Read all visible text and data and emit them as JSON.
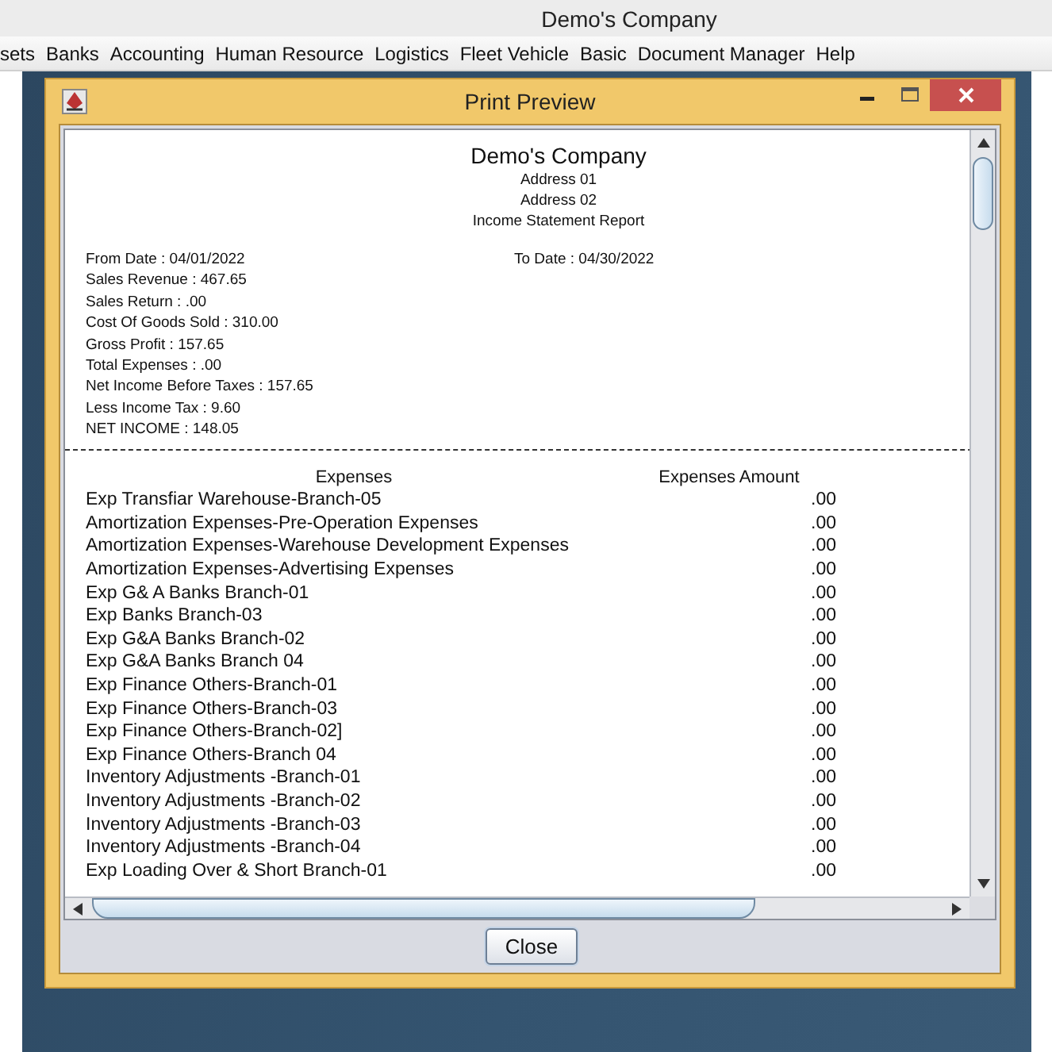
{
  "window": {
    "title": "Demo's Company"
  },
  "menu": [
    "sets",
    "Banks",
    "Accounting",
    "Human Resource",
    "Logistics",
    "Fleet Vehicle",
    "Basic",
    "Document Manager",
    "Help"
  ],
  "dialog": {
    "title": "Print Preview",
    "close_button": "Close"
  },
  "report": {
    "company": "Demo's Company",
    "address_lines": [
      "Address 01",
      "Address 02"
    ],
    "report_title": "Income Statement Report",
    "from_date": "From Date : 04/01/2022",
    "to_date": "To Date : 04/30/2022",
    "summary": [
      "Sales Revenue : 467.65",
      "Sales Return : .00",
      "Cost Of Goods Sold : 310.00",
      "Gross Profit : 157.65",
      "Total Expenses : .00",
      "Net Income Before Taxes : 157.65",
      "Less Income Tax : 9.60",
      "NET INCOME : 148.05"
    ],
    "columns": [
      "Expenses",
      "Expenses Amount"
    ],
    "rows": [
      {
        "name": "Exp Transfiar Warehouse-Branch-05",
        "amount": ".00"
      },
      {
        "name": "Amortization Expenses-Pre-Operation Expenses",
        "amount": ".00"
      },
      {
        "name": "Amortization  Expenses-Warehouse Development Expenses",
        "amount": ".00"
      },
      {
        "name": "Amortization  Expenses-Advertising Expenses",
        "amount": ".00"
      },
      {
        "name": "Exp G& A Banks Branch-01",
        "amount": ".00"
      },
      {
        "name": "Exp Banks Branch-03",
        "amount": ".00"
      },
      {
        "name": "Exp G&A Banks Branch-02",
        "amount": ".00"
      },
      {
        "name": "Exp G&A Banks Branch 04",
        "amount": ".00"
      },
      {
        "name": "Exp Finance Others-Branch-01",
        "amount": ".00"
      },
      {
        "name": "Exp Finance Others-Branch-03",
        "amount": ".00"
      },
      {
        "name": "Exp Finance Others-Branch-02]",
        "amount": ".00"
      },
      {
        "name": "Exp Finance Others-Branch 04",
        "amount": ".00"
      },
      {
        "name": "Inventory Adjustments -Branch-01",
        "amount": ".00"
      },
      {
        "name": "Inventory Adjustments -Branch-02",
        "amount": ".00"
      },
      {
        "name": "Inventory Adjustments -Branch-03",
        "amount": ".00"
      },
      {
        "name": "Inventory Adjustments -Branch-04",
        "amount": ".00"
      },
      {
        "name": "Exp Loading Over & Short Branch-01",
        "amount": ".00"
      }
    ]
  }
}
